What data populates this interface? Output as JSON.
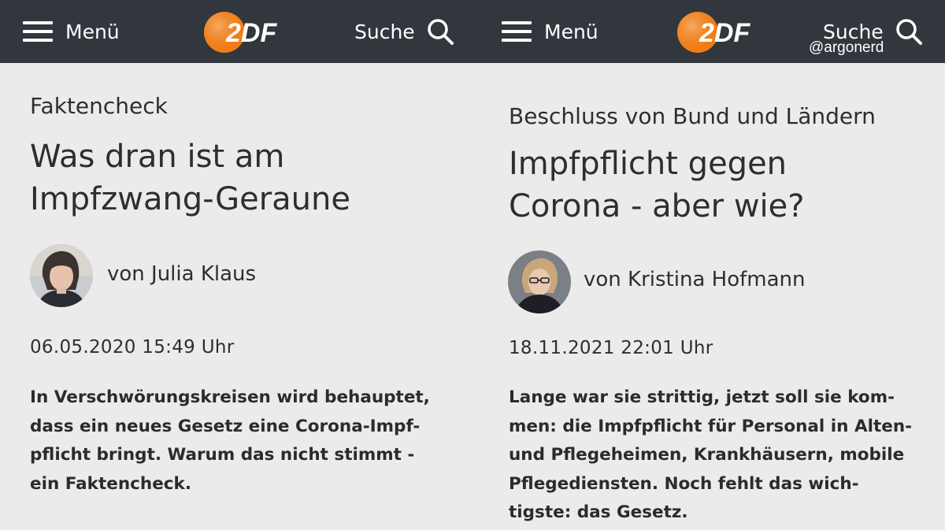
{
  "left": {
    "header": {
      "menu_label": "Menü",
      "logo_text": "2DF",
      "search_label": "Suche"
    },
    "article": {
      "kicker": "Faktencheck",
      "headline_lines": [
        "Was dran ist am",
        "Impfzwang-Geraune"
      ],
      "author": "von Julia Klaus",
      "datetime": "06.05.2020 15:49 Uhr",
      "teaser_lines": [
        "In Verschwörungskreisen wird behauptet,",
        "dass ein neues Gesetz eine Corona-Impf-",
        "pflicht bringt. Warum das nicht stimmt -",
        "ein Faktencheck."
      ]
    }
  },
  "right": {
    "header": {
      "menu_label": "Menü",
      "logo_text": "2DF",
      "search_label": "Suche",
      "watermark": "@argonerd"
    },
    "article": {
      "kicker": "Beschluss von Bund und Ländern",
      "headline_lines": [
        "Impfpflicht gegen",
        "Corona - aber wie?"
      ],
      "author": "von Kristina Hofmann",
      "datetime": "18.11.2021 22:01 Uhr",
      "teaser_lines": [
        "Lange war sie strittig, jetzt soll sie kom-",
        "men: die Impfpflicht für Personal in Alten-",
        "und Pflegeheimen, Krankhäusern, mobile",
        "Pflegediensten. Noch fehlt das wich-",
        "tigste: das Gesetz."
      ]
    }
  },
  "colors": {
    "header_bg": "#32363d",
    "page_bg": "#ebebeb",
    "logo_orange": "#f07c14",
    "text": "#2e2e2e"
  },
  "icons": [
    "hamburger-menu-icon",
    "zdf-logo",
    "search-icon",
    "author-avatar"
  ]
}
